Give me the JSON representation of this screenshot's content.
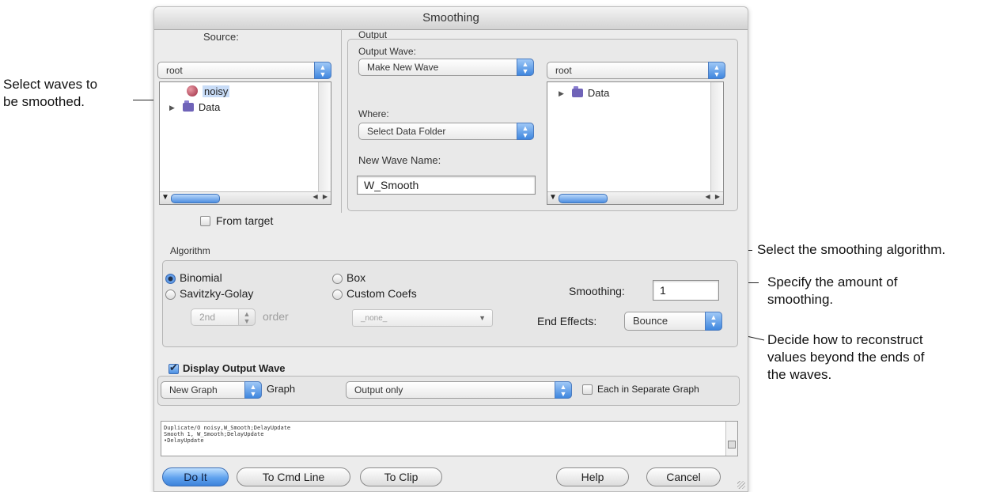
{
  "callouts": {
    "select_waves": [
      "Select waves to",
      "be smoothed."
    ],
    "select_algorithm": "Select the smoothing algorithm.",
    "amount": [
      "Specify the amount of",
      "smoothing."
    ],
    "end_effects": [
      "Decide how to reconstruct",
      "values beyond the ends of",
      "the waves."
    ]
  },
  "dialog": {
    "title": "Smoothing",
    "source": {
      "label": "Source:",
      "folder_popup": "root",
      "items": [
        {
          "name": "noisy",
          "icon": "wave-icon",
          "selected": true
        },
        {
          "name": "Data",
          "icon": "folder-icon"
        }
      ],
      "from_target_label": "From target"
    },
    "output": {
      "group_label": "Output",
      "output_wave_label": "Output Wave:",
      "output_wave_popup": "Make New Wave",
      "where_label": "Where:",
      "where_popup": "Select Data Folder",
      "new_wave_name_label": "New Wave Name:",
      "new_wave_name_value": "W_Smooth",
      "folder_popup": "root",
      "items": [
        {
          "name": "Data",
          "icon": "folder-icon"
        }
      ]
    },
    "algorithm": {
      "group_label": "Algorithm",
      "binomial": "Binomial",
      "savitzky_golay": "Savitzky-Golay",
      "box": "Box",
      "custom_coefs": "Custom Coefs",
      "selected": "Binomial",
      "order_popup": "2nd",
      "order_label": "order",
      "coefs_popup": "_none_",
      "smoothing_label": "Smoothing:",
      "smoothing_value": "1",
      "end_effects_label": "End Effects:",
      "end_effects_popup": "Bounce"
    },
    "display": {
      "checkbox_label": "Display Output Wave",
      "checked": true,
      "graph_popup": "New Graph",
      "graph_label": "Graph",
      "output_popup": "Output only",
      "separate_label": "Each in Separate Graph"
    },
    "history": [
      "Duplicate/O noisy,W_Smooth;DelayUpdate",
      "Smooth 1, W_Smooth;DelayUpdate",
      "•DelayUpdate"
    ],
    "buttons": {
      "do_it": "Do It",
      "to_cmd_line": "To Cmd Line",
      "to_clip": "To Clip",
      "help": "Help",
      "cancel": "Cancel"
    }
  }
}
